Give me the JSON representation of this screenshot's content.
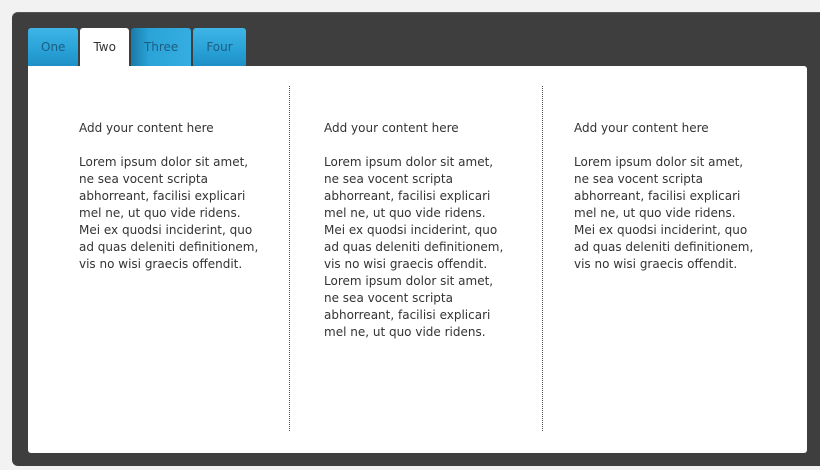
{
  "tabs": [
    {
      "label": "One",
      "active": false
    },
    {
      "label": "Two",
      "active": true
    },
    {
      "label": "Three",
      "active": false
    },
    {
      "label": "Four",
      "active": false
    }
  ],
  "columns": [
    {
      "heading": "Add your content here",
      "body": "Lorem ipsum dolor sit amet, ne sea vocent scripta abhorreant, facilisi explicari mel ne, ut quo vide ridens. Mei ex quodsi inciderint, quo ad quas deleniti definitionem, vis no wisi graecis offendit."
    },
    {
      "heading": "Add your content here",
      "body": "Lorem ipsum dolor sit amet, ne sea vocent scripta abhorreant, facilisi explicari mel ne, ut quo vide ridens. Mei ex quodsi inciderint, quo ad quas deleniti definitionem, vis no wisi graecis offendit. Lorem ipsum dolor sit amet, ne sea vocent scripta abhorreant, facilisi explicari mel ne, ut quo vide ridens."
    },
    {
      "heading": "Add your content here",
      "body": "Lorem ipsum dolor sit amet, ne sea vocent scripta abhorreant, facilisi explicari mel ne, ut quo vide ridens. Mei ex quodsi inciderint, quo ad quas deleniti definitionem, vis no wisi graecis offendit."
    }
  ],
  "colors": {
    "frame": "#3e3e3e",
    "tab_accent": "#2aa3d8",
    "tab_text": "#1d5d80",
    "panel": "#ffffff",
    "text": "#333333"
  }
}
